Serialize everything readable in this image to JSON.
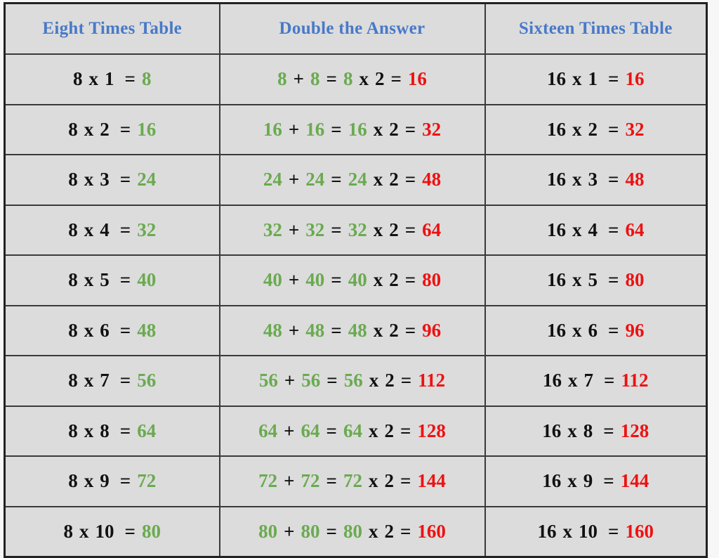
{
  "document": {
    "kind": "multiplication-times-table",
    "background_color": "#f7f7f7",
    "cell_background_color": "#dcdcdc",
    "border_color": "#3a3a3a"
  },
  "colors": {
    "header": "#4879c8",
    "green": "#6aaa50",
    "red": "#ee1111",
    "black": "#111111"
  },
  "table": {
    "headers": [
      "Eight Times Table",
      "Double the Answer",
      "Sixteen Times Table"
    ],
    "symbols": {
      "times": "x",
      "equals": "=",
      "plus": "+",
      "doubler": "2"
    },
    "rows": [
      {
        "left": {
          "a": "8",
          "times": "x",
          "b": "1",
          "equals": "=",
          "product": "8"
        },
        "middle": {
          "addend1": "8",
          "plus": "+",
          "addend2": "8",
          "equals1": "=",
          "base": "8",
          "times": "x",
          "factor": "2",
          "equals2": "=",
          "result": "16"
        },
        "right": {
          "a": "16",
          "times": "x",
          "b": "1",
          "equals": "=",
          "product": "16"
        }
      },
      {
        "left": {
          "a": "8",
          "times": "x",
          "b": "2",
          "equals": "=",
          "product": "16"
        },
        "middle": {
          "addend1": "16",
          "plus": "+",
          "addend2": "16",
          "equals1": "=",
          "base": "16",
          "times": "x",
          "factor": "2",
          "equals2": "=",
          "result": "32"
        },
        "right": {
          "a": "16",
          "times": "x",
          "b": "2",
          "equals": "=",
          "product": "32"
        }
      },
      {
        "left": {
          "a": "8",
          "times": "x",
          "b": "3",
          "equals": "=",
          "product": "24"
        },
        "middle": {
          "addend1": "24",
          "plus": "+",
          "addend2": "24",
          "equals1": "=",
          "base": "24",
          "times": "x",
          "factor": "2",
          "equals2": "=",
          "result": "48"
        },
        "right": {
          "a": "16",
          "times": "x",
          "b": "3",
          "equals": "=",
          "product": "48"
        }
      },
      {
        "left": {
          "a": "8",
          "times": "x",
          "b": "4",
          "equals": "=",
          "product": "32"
        },
        "middle": {
          "addend1": "32",
          "plus": "+",
          "addend2": "32",
          "equals1": "=",
          "base": "32",
          "times": "x",
          "factor": "2",
          "equals2": "=",
          "result": "64"
        },
        "right": {
          "a": "16",
          "times": "x",
          "b": "4",
          "equals": "=",
          "product": "64"
        }
      },
      {
        "left": {
          "a": "8",
          "times": "x",
          "b": "5",
          "equals": "=",
          "product": "40"
        },
        "middle": {
          "addend1": "40",
          "plus": "+",
          "addend2": "40",
          "equals1": "=",
          "base": "40",
          "times": "x",
          "factor": "2",
          "equals2": "=",
          "result": "80"
        },
        "right": {
          "a": "16",
          "times": "x",
          "b": "5",
          "equals": "=",
          "product": "80"
        }
      },
      {
        "left": {
          "a": "8",
          "times": "x",
          "b": "6",
          "equals": "=",
          "product": "48"
        },
        "middle": {
          "addend1": "48",
          "plus": "+",
          "addend2": "48",
          "equals1": "=",
          "base": "48",
          "times": "x",
          "factor": "2",
          "equals2": "=",
          "result": "96"
        },
        "right": {
          "a": "16",
          "times": "x",
          "b": "6",
          "equals": "=",
          "product": "96"
        }
      },
      {
        "left": {
          "a": "8",
          "times": "x",
          "b": "7",
          "equals": "=",
          "product": "56"
        },
        "middle": {
          "addend1": "56",
          "plus": "+",
          "addend2": "56",
          "equals1": "=",
          "base": "56",
          "times": "x",
          "factor": "2",
          "equals2": "=",
          "result": "112"
        },
        "right": {
          "a": "16",
          "times": "x",
          "b": "7",
          "equals": "=",
          "product": "112"
        }
      },
      {
        "left": {
          "a": "8",
          "times": "x",
          "b": "8",
          "equals": "=",
          "product": "64"
        },
        "middle": {
          "addend1": "64",
          "plus": "+",
          "addend2": "64",
          "equals1": "=",
          "base": "64",
          "times": "x",
          "factor": "2",
          "equals2": "=",
          "result": "128"
        },
        "right": {
          "a": "16",
          "times": "x",
          "b": "8",
          "equals": "=",
          "product": "128"
        }
      },
      {
        "left": {
          "a": "8",
          "times": "x",
          "b": "9",
          "equals": "=",
          "product": "72"
        },
        "middle": {
          "addend1": "72",
          "plus": "+",
          "addend2": "72",
          "equals1": "=",
          "base": "72",
          "times": "x",
          "factor": "2",
          "equals2": "=",
          "result": "144"
        },
        "right": {
          "a": "16",
          "times": "x",
          "b": "9",
          "equals": "=",
          "product": "144"
        }
      },
      {
        "left": {
          "a": "8",
          "times": "x",
          "b": "10",
          "equals": "=",
          "product": "80"
        },
        "middle": {
          "addend1": "80",
          "plus": "+",
          "addend2": "80",
          "equals1": "=",
          "base": "80",
          "times": "x",
          "factor": "2",
          "equals2": "=",
          "result": "160"
        },
        "right": {
          "a": "16",
          "times": "x",
          "b": "10",
          "equals": "=",
          "product": "160"
        }
      }
    ]
  }
}
